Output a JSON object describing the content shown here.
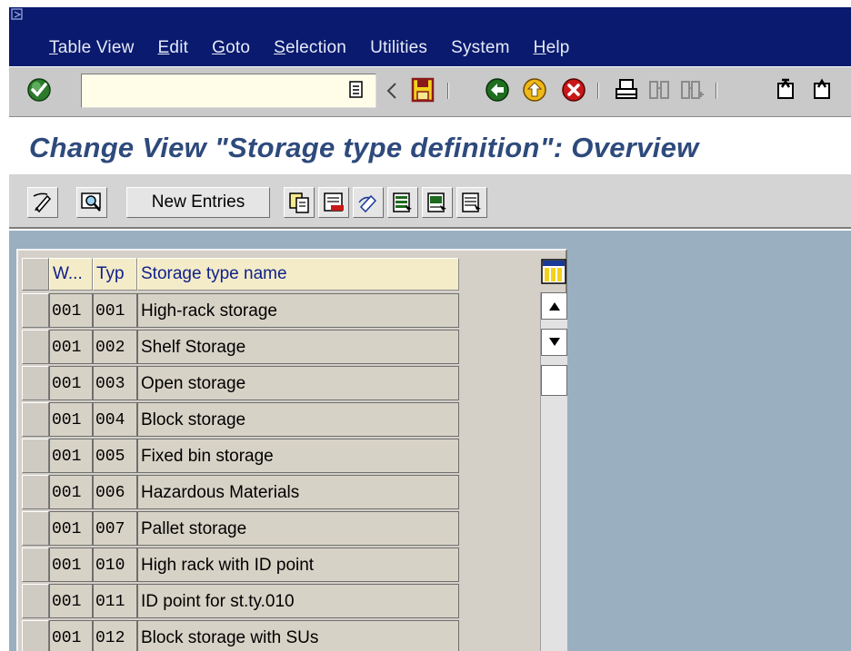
{
  "menu": {
    "items": [
      {
        "key": "T",
        "rest": "able View"
      },
      {
        "key": "E",
        "rest": "dit"
      },
      {
        "key": "G",
        "rest": "oto"
      },
      {
        "key": "S",
        "rest": "election"
      },
      {
        "key": "",
        "rest": "Utilities"
      },
      {
        "key": "",
        "rest": "System"
      },
      {
        "key": "H",
        "rest": "elp"
      }
    ]
  },
  "toolbar": {
    "command_field_value": "",
    "icons": [
      "enter-icon",
      "history-icon",
      "back-arrow-icon",
      "save-icon",
      "back-icon",
      "exit-icon",
      "cancel-icon",
      "print-icon",
      "find-icon",
      "find-next-icon",
      "first-page-icon",
      "previous-page-icon"
    ]
  },
  "title": "Change View \"Storage type definition\": Overview",
  "app_toolbar": {
    "new_entries_label": "New Entries",
    "icons": [
      "display-change-icon",
      "details-icon",
      "copy-as-icon",
      "delete-icon",
      "undo-change-icon",
      "select-all-icon",
      "select-block-icon",
      "deselect-all-icon"
    ]
  },
  "table": {
    "columns": [
      "W...",
      "Typ",
      "Storage type name"
    ],
    "rows": [
      [
        "001",
        "001",
        "High-rack storage"
      ],
      [
        "001",
        "002",
        "Shelf Storage"
      ],
      [
        "001",
        "003",
        "Open storage"
      ],
      [
        "001",
        "004",
        "Block storage"
      ],
      [
        "001",
        "005",
        "Fixed bin storage"
      ],
      [
        "001",
        "006",
        "Hazardous Materials"
      ],
      [
        "001",
        "007",
        "Pallet storage"
      ],
      [
        "001",
        "010",
        "High rack with ID point"
      ],
      [
        "001",
        "011",
        "ID point for st.ty.010"
      ],
      [
        "001",
        "012",
        "Block storage with SUs"
      ]
    ]
  },
  "colors": {
    "menubar": "#0a1a6e",
    "title": "#2e4a7c",
    "content_bg": "#9ab0c0",
    "header_text": "#10208c"
  }
}
